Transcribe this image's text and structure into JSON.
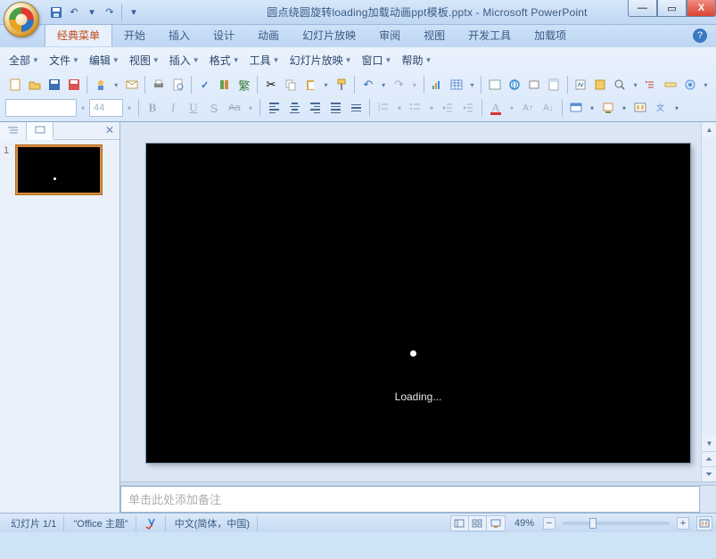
{
  "title": {
    "filename": "圆点绕圆旋转loading加载动画ppt模板.pptx",
    "appname": "Microsoft PowerPoint",
    "separator": " - "
  },
  "qat": {
    "save": "💾",
    "undo": "↶",
    "redo": "↷"
  },
  "ribbon_tabs": [
    "经典菜单",
    "开始",
    "插入",
    "设计",
    "动画",
    "幻灯片放映",
    "审阅",
    "视图",
    "开发工具",
    "加载项"
  ],
  "active_tab_index": 0,
  "menus": [
    "全部",
    "文件",
    "编辑",
    "视图",
    "插入",
    "格式",
    "工具",
    "幻灯片放映",
    "窗口",
    "帮助"
  ],
  "font": {
    "name": "",
    "size": "44"
  },
  "thumb_tabs": {
    "outline_icon": "≣",
    "slides_icon": "▭"
  },
  "slide": {
    "number": "1",
    "loading_text": "Loading..."
  },
  "notes": {
    "placeholder": "单击此处添加备注"
  },
  "status": {
    "slide_counter": "幻灯片 1/1",
    "theme": "\"Office 主题\"",
    "language": "中文(简体，中国)",
    "zoom": "49%"
  },
  "win": {
    "min": "—",
    "max": "▭",
    "close": "X"
  }
}
